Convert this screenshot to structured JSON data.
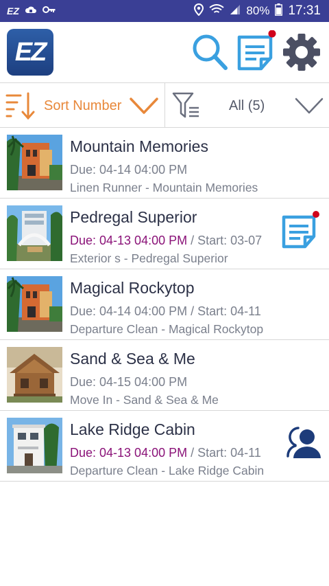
{
  "status_bar": {
    "app_badge": "EZ",
    "battery_percent": "80%",
    "time": "17:31"
  },
  "app": {
    "logo_text": "EZ"
  },
  "filter_bar": {
    "sort_label": "Sort Number",
    "filter_label": "All (5)"
  },
  "tasks": [
    {
      "title": "Mountain Memories",
      "due": "Due: 04-14 04:00 PM",
      "start": "",
      "description": "Linen Runner - Mountain Memories",
      "urgent": false,
      "thumb": "orange-villa",
      "badge_icon": ""
    },
    {
      "title": "Pedregal Superior",
      "due": "Due: 04-13 04:00 PM",
      "start": " / Start: 03-07",
      "description": "Exterior s - Pedregal Superior",
      "urgent": true,
      "thumb": "white-arch-building",
      "badge_icon": "notes-icon"
    },
    {
      "title": "Magical Rockytop",
      "due": "Due: 04-14 04:00 PM",
      "start": " / Start: 04-11",
      "description": "Departure Clean - Magical Rockytop",
      "urgent": false,
      "thumb": "orange-villa",
      "badge_icon": ""
    },
    {
      "title": "Sand & Sea & Me",
      "due": "Due: 04-15 04:00 PM",
      "start": "",
      "description": "Move In - Sand & Sea & Me",
      "urgent": false,
      "thumb": "wooden-cabin",
      "badge_icon": ""
    },
    {
      "title": "Lake Ridge Cabin",
      "due": "Due: 04-13 04:00 PM",
      "start": " / Start: 04-11",
      "description": "Departure Clean - Lake Ridge Cabin",
      "urgent": true,
      "thumb": "white-house",
      "badge_icon": "person-icon"
    }
  ],
  "colors": {
    "status_bar": "#3a3f95",
    "accent_blue": "#3aa0e0",
    "sort_orange": "#e8883a",
    "urgent_due": "#8a1278",
    "notification_dot": "#d0021b"
  }
}
